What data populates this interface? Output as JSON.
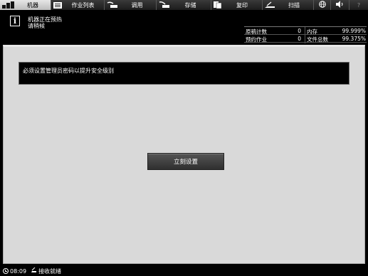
{
  "nav": {
    "machine": "机器",
    "job_list": "作业列表",
    "recall": "调用",
    "store": "存储",
    "copy": "复印",
    "scan": "扫描",
    "help": "?"
  },
  "status": {
    "message_line1": "机器正在预热",
    "message_line2": "请稍候",
    "counters": [
      {
        "label": "原稿计数",
        "value": "0",
        "label2": "内存",
        "value2": "99.999%"
      },
      {
        "label": "预约作业",
        "value": "0",
        "label2": "文件总数",
        "value2": "99.375%"
      }
    ]
  },
  "main": {
    "alert": "必须设置管理员密码以提升安全级别",
    "set_button": "立刻设置"
  },
  "bottom": {
    "time": "08:09",
    "receive": "接收就绪"
  }
}
